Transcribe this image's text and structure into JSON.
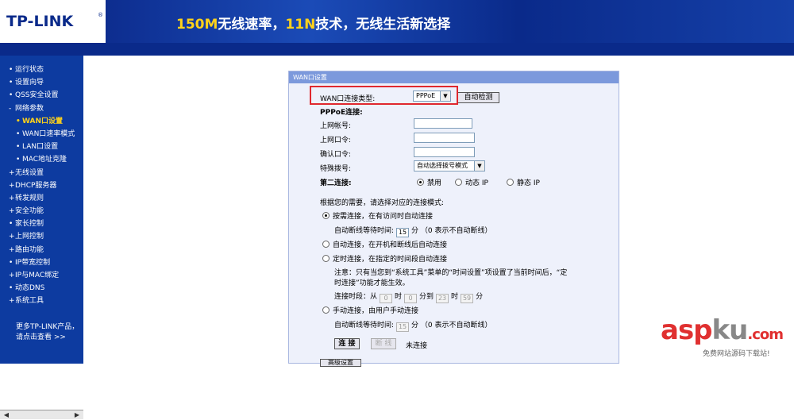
{
  "header": {
    "logo": "TP-LINK",
    "logo_mark": "®",
    "slogan_part1": "150M",
    "slogan_part2": "无线速率，",
    "slogan_part3": "11N",
    "slogan_part4": "技术，无线生活新选择"
  },
  "sidebar": {
    "items": [
      {
        "label": "运行状态",
        "bullet": "•"
      },
      {
        "label": "设置向导",
        "bullet": "•"
      },
      {
        "label": "QSS安全设置",
        "bullet": "•"
      },
      {
        "label": "网络参数",
        "bullet": "-"
      },
      {
        "label": "WAN口设置",
        "bullet": "•"
      },
      {
        "label": "WAN口速率模式",
        "bullet": "•"
      },
      {
        "label": "LAN口设置",
        "bullet": "•"
      },
      {
        "label": "MAC地址克隆",
        "bullet": "•"
      },
      {
        "label": "无线设置",
        "bullet": "+"
      },
      {
        "label": "DHCP服务器",
        "bullet": "+"
      },
      {
        "label": "转发规则",
        "bullet": "+"
      },
      {
        "label": "安全功能",
        "bullet": "+"
      },
      {
        "label": "家长控制",
        "bullet": "•"
      },
      {
        "label": "上网控制",
        "bullet": "+"
      },
      {
        "label": "路由功能",
        "bullet": "+"
      },
      {
        "label": "IP带宽控制",
        "bullet": "•"
      },
      {
        "label": "IP与MAC绑定",
        "bullet": "+"
      },
      {
        "label": "动态DNS",
        "bullet": "•"
      },
      {
        "label": "系统工具",
        "bullet": "+"
      }
    ],
    "more_line1": "更多TP-LINK产品，",
    "more_line2": "请点击查看 >>"
  },
  "panel": {
    "title": "WAN口设置",
    "wan_type_label": "WAN口连接类型:",
    "wan_type_value": "PPPoE",
    "auto_detect": "自动检测",
    "pppoe_label": "PPPoE连接:",
    "account_label": "上网帐号:",
    "password_label": "上网口令:",
    "confirm_label": "确认口令:",
    "dial_label": "特殊拨号:",
    "dial_value": "自动选择拨号模式",
    "second_label": "第二连接:",
    "second_opt1": "禁用",
    "second_opt2": "动态 IP",
    "second_opt3": "静态 IP",
    "mode_intro": "根据您的需要，请选择对应的连接模式:",
    "mode1": "按需连接，在有访问时自动连接",
    "idle1_prefix": "自动断线等待时间:",
    "idle1_value": "15",
    "idle1_suffix": "分 （0 表示不自动断线）",
    "mode2": "自动连接，在开机和断线后自动连接",
    "mode3": "定时连接，在指定的时间段自动连接",
    "note_line1": "注意：只有当您到“系统工具”菜单的“时间设置”项设置了当前时间后，“定",
    "note_line2": "时连接”功能才能生效。",
    "period_prefix": "连接时段：从",
    "h1": "0",
    "t_hour": "时",
    "m1": "0",
    "t_to": "分到",
    "h2": "23",
    "t_hour2": "时",
    "m2": "59",
    "t_min": "分",
    "mode4": "手动连接，由用户手动连接",
    "idle2_prefix": "自动断线等待时间:",
    "idle2_value": "15",
    "idle2_suffix": "分 （0 表示不自动断线）",
    "connect_btn": "连 接",
    "disconnect_btn": "断 线",
    "status": "未连接",
    "advanced_btn": "高级设置"
  },
  "watermark": {
    "asp": "asp",
    "ku": "ku",
    "com": ".com",
    "sub": "免费网站源码下载站!"
  }
}
